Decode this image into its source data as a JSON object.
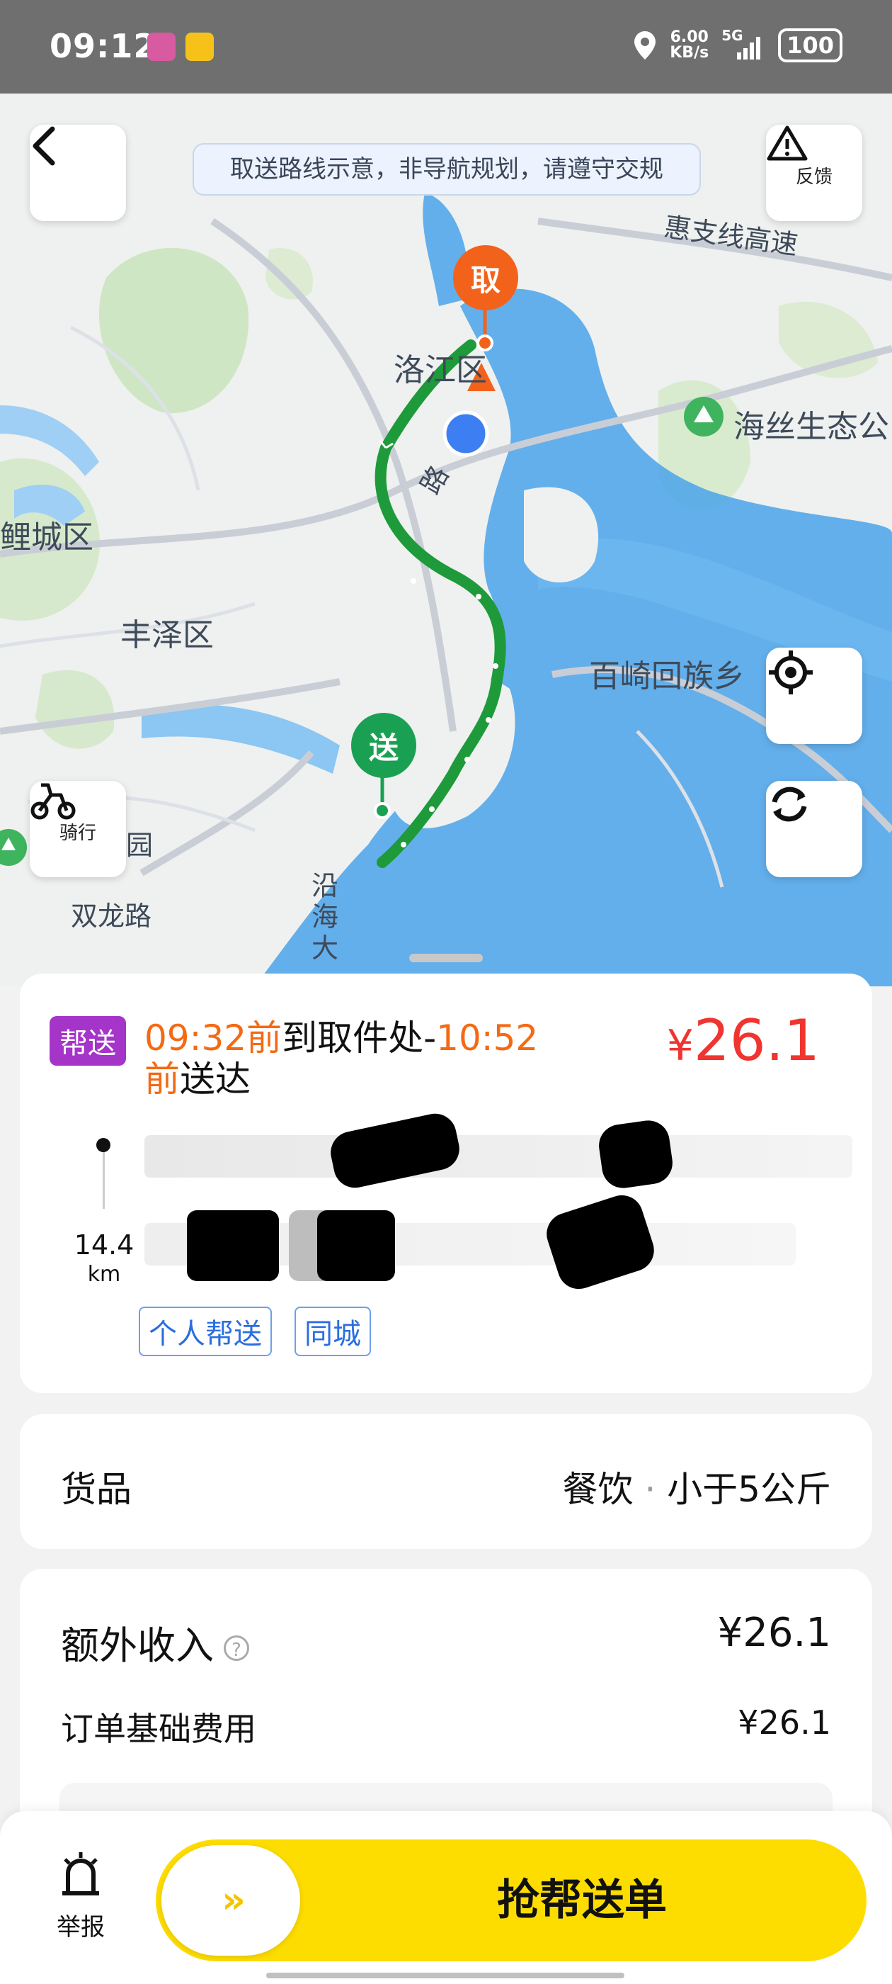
{
  "status_bar": {
    "time": "09:12",
    "speed_value": "6.00",
    "speed_unit": "KB/s",
    "network": "5G",
    "battery": "100"
  },
  "map": {
    "notice": "取送路线示意，非导航规划，请遵守交规",
    "feedback_label": "反馈",
    "ride_label": "骑行",
    "pickup_pin": "取",
    "dropoff_pin": "送",
    "place_labels": {
      "luojiang": "洛江区",
      "haisi_park": "海丝生态公",
      "licheng": "鲤城区",
      "fengze": "丰泽区",
      "baiqi": "百崎回族乡",
      "expressway": "惠支线高速",
      "shuanglong": "双龙路",
      "yuan": "园",
      "lu": "路",
      "yanhai_1": "沿",
      "yanhai_2": "海",
      "yanhai_3": "大"
    },
    "colors": {
      "route": "#1e9a3a",
      "water": "#4aa3ea",
      "pickup": "#f3621b",
      "dropoff": "#1aa052",
      "location": "#3d7ff2"
    }
  },
  "order": {
    "badge": "帮送",
    "pickup_time": "09:32前",
    "pickup_text": "到取件处-",
    "deliver_time": "10:52",
    "deliver_time_suffix": "前",
    "deliver_text": "送达",
    "price": "26.1",
    "currency": "¥",
    "distance_value": "14.4",
    "distance_unit": "km",
    "tags": [
      "个人帮送",
      "同城"
    ]
  },
  "goods": {
    "label": "货品",
    "category": "餐饮",
    "separator": "·",
    "weight": "小于5公斤"
  },
  "income": {
    "label": "额外收入",
    "help_icon": "?",
    "value": "¥26.1",
    "base_fee_label": "订单基础费用",
    "base_fee_value": "¥26.1"
  },
  "bottom": {
    "report_label": "举报",
    "grab_button": "抢帮送单",
    "slide_arrows": "»"
  }
}
